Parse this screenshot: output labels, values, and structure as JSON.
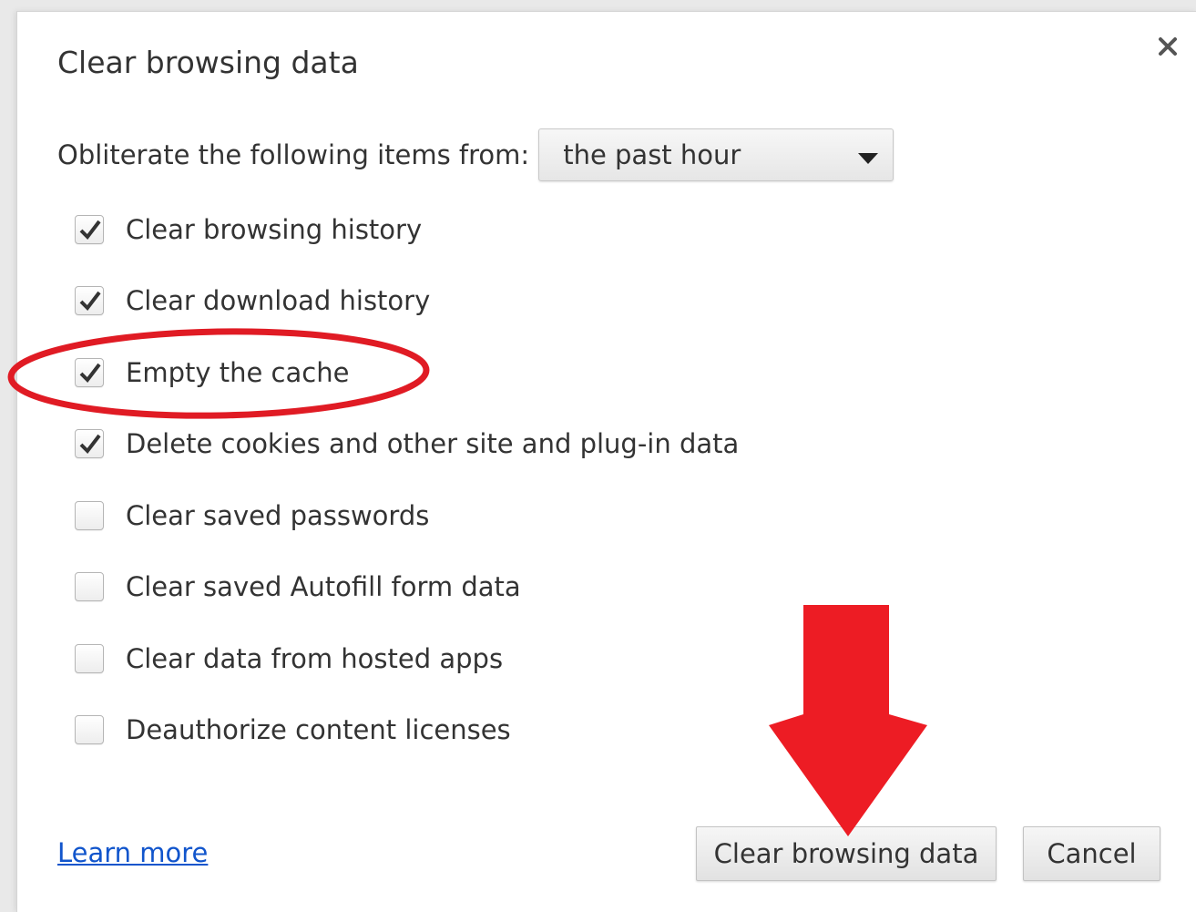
{
  "dialog": {
    "title": "Clear browsing data",
    "close_icon": "close-icon"
  },
  "time_range": {
    "label": "Obliterate the following items from:",
    "selected": "the past hour"
  },
  "options": [
    {
      "label": "Clear browsing history",
      "checked": true
    },
    {
      "label": "Clear download history",
      "checked": true
    },
    {
      "label": "Empty the cache",
      "checked": true
    },
    {
      "label": "Delete cookies and other site and plug-in data",
      "checked": true
    },
    {
      "label": "Clear saved passwords",
      "checked": false
    },
    {
      "label": "Clear saved Autofill form data",
      "checked": false
    },
    {
      "label": "Clear data from hosted apps",
      "checked": false
    },
    {
      "label": "Deauthorize content licenses",
      "checked": false
    }
  ],
  "footer": {
    "learn_more": "Learn more",
    "clear_button": "Clear browsing data",
    "cancel_button": "Cancel"
  },
  "annotations": {
    "highlight_color": "#e01b24",
    "arrow_color": "#ed1c24",
    "highlighted_option": "Empty the cache"
  }
}
